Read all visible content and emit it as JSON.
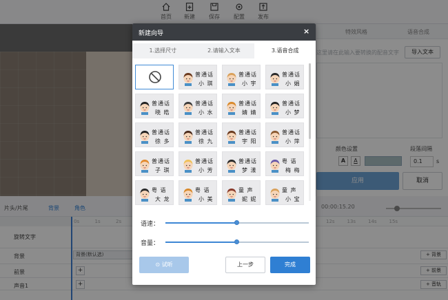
{
  "toolbar": {
    "home": "首页",
    "new": "新建",
    "save": "保存",
    "settings": "配置",
    "publish": "发布"
  },
  "right_panel": {
    "tab_effects": "特效风格",
    "tab_synthesis": "语音合成",
    "hint": "这里请在此输入要转换的配音文字",
    "import_label": "导入文本",
    "color_label": "颜色设置",
    "spacing_label": "段落间隔",
    "spacing_value": "0.1",
    "spacing_unit": "s",
    "apply_label": "应用",
    "cancel_label": "取消",
    "fmt_a1": "A",
    "fmt_a2": "A",
    "accent_color": "#a9c0c3"
  },
  "timeline": {
    "toolbar_item1": "片头/片尾",
    "toolbar_item2": "背景",
    "toolbar_item3": "角色",
    "time": "00:00:15.20",
    "ruler": [
      "0s",
      "1s",
      "2s",
      "3s",
      "4s",
      "5s",
      "6s",
      "7s",
      "8s",
      "9s",
      "10s",
      "11s",
      "12s",
      "13s",
      "14s",
      "15s"
    ],
    "tracks": [
      {
        "name": "旋转文字",
        "right": ""
      },
      {
        "name": "背景",
        "right": "+ 背景",
        "clip": "背景(默认选)"
      },
      {
        "name": "前景",
        "right": "+ 前景",
        "clip": ""
      },
      {
        "name": "声音1",
        "right": "+ 音轨",
        "clip": ""
      }
    ]
  },
  "dialog": {
    "title": "新建向导",
    "close": "×",
    "steps": [
      "1.选择尺寸",
      "2.请输入文本",
      "3.语音合成"
    ],
    "active_step": 2,
    "voices": [
      {
        "none": true
      },
      {
        "l1": "普通话",
        "l2": "小 琪",
        "hair": "#6b3a1e",
        "skin": "#f6d5b8"
      },
      {
        "l1": "普通话",
        "l2": "小 宇",
        "hair": "#d9a15b",
        "skin": "#f6d5b8"
      },
      {
        "l1": "普通话",
        "l2": "小 娟",
        "hair": "#2a2a2a",
        "skin": "#f6d5b8"
      },
      {
        "l1": "普通话",
        "l2": "晓 皓",
        "hair": "#222222",
        "skin": "#f6d5b8"
      },
      {
        "l1": "普通话",
        "l2": "小 水",
        "hair": "#3a3a3a",
        "skin": "#f6d5b8"
      },
      {
        "l1": "普通话",
        "l2": "婧 婧",
        "hair": "#d98a2c",
        "skin": "#f6d5b8"
      },
      {
        "l1": "普通话",
        "l2": "小 梦",
        "hair": "#222222",
        "skin": "#f6d5b8"
      },
      {
        "l1": "普通话",
        "l2": "徐 多",
        "hair": "#222222",
        "skin": "#f6d5b8"
      },
      {
        "l1": "普通话",
        "l2": "徐 九",
        "hair": "#4a2a1a",
        "skin": "#f6d5b8"
      },
      {
        "l1": "普通话",
        "l2": "宇 阳",
        "hair": "#6b3a1e",
        "skin": "#f6d5b8"
      },
      {
        "l1": "普通话",
        "l2": "小 萍",
        "hair": "#8a5a30",
        "skin": "#f6d5b8"
      },
      {
        "l1": "普通话",
        "l2": "子 琪",
        "hair": "#e28b2f",
        "skin": "#f6d5b8"
      },
      {
        "l1": "普通话",
        "l2": "小 芳",
        "hair": "#f0c15a",
        "skin": "#f6d5b8"
      },
      {
        "l1": "普通话",
        "l2": "梦 漾",
        "hair": "#2a2a2a",
        "skin": "#f6d5b8"
      },
      {
        "l1": "粤 语",
        "l2": "梅 梅",
        "hair": "#6b5aa8",
        "skin": "#f6d5b8"
      },
      {
        "l1": "粤 语",
        "l2": "大 龙",
        "hair": "#2a2a2a",
        "skin": "#f6d5b8"
      },
      {
        "l1": "粤 语",
        "l2": "小 美",
        "hair": "#d98a2c",
        "skin": "#f6d5b8"
      },
      {
        "l1": "童 声",
        "l2": "妮 妮",
        "hair": "#8a3a2a",
        "skin": "#f6d5b8"
      },
      {
        "l1": "童 声",
        "l2": "小 宝",
        "hair": "#d9a15b",
        "skin": "#f6d5b8"
      }
    ],
    "speed_label": "语速：",
    "speed_value": 0.5,
    "volume_label": "音量：",
    "volume_value": 0.5,
    "listen_label": "试听",
    "prev_label": "上一步",
    "finish_label": "完成"
  }
}
